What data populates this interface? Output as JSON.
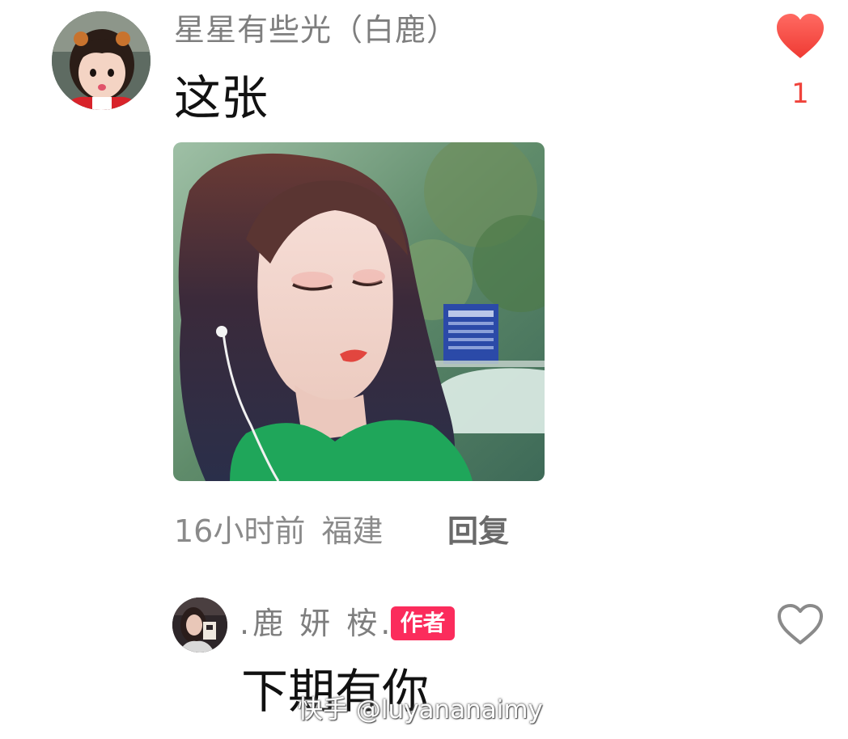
{
  "comment": {
    "author": "星星有些光（白鹿）",
    "text": "这张",
    "likes": "1",
    "liked": true,
    "time": "16小时前",
    "location": "福建",
    "reply_label": "回复"
  },
  "reply": {
    "author": ".鹿 妍 桉.",
    "badge": "作者",
    "text": "下期有你",
    "liked": false
  },
  "watermark": "快手 @luyananaimy",
  "colors": {
    "like_red": "#f0433b",
    "badge_pink": "#fb2c5c",
    "name_gray": "#7e7e7e"
  }
}
